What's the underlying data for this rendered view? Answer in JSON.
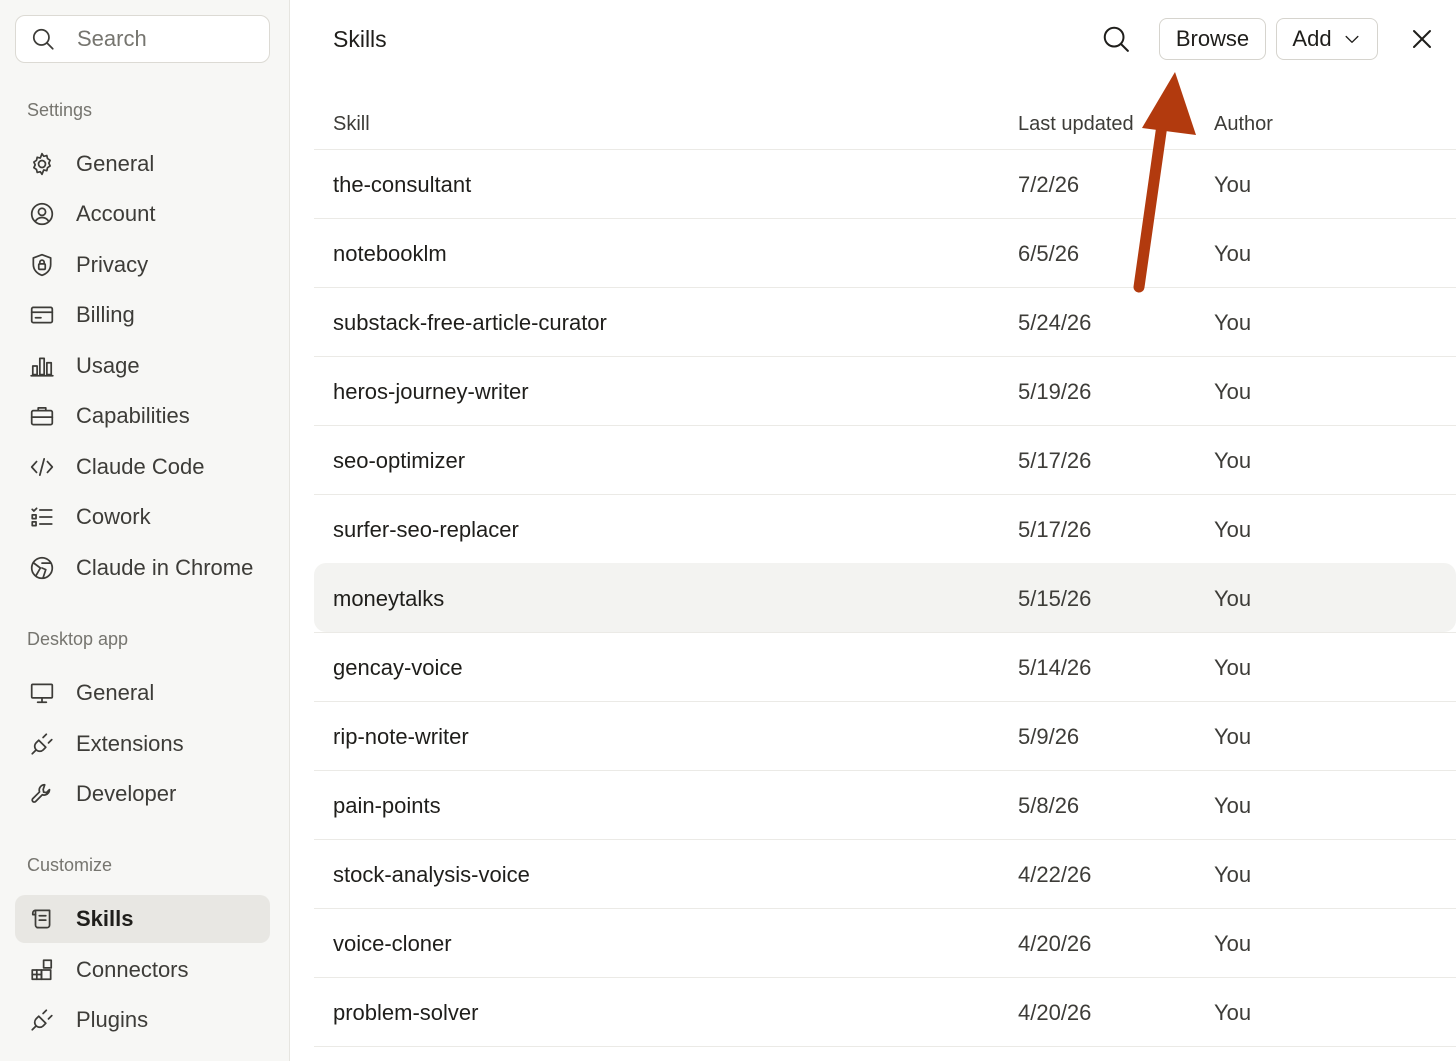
{
  "sidebar": {
    "search_placeholder": "Search",
    "sections": {
      "settings": "Settings",
      "desktop": "Desktop app",
      "customize": "Customize"
    },
    "settings_items": [
      {
        "label": "General",
        "icon": "gear-icon"
      },
      {
        "label": "Account",
        "icon": "user-circle-icon"
      },
      {
        "label": "Privacy",
        "icon": "shield-lock-icon"
      },
      {
        "label": "Billing",
        "icon": "credit-card-icon"
      },
      {
        "label": "Usage",
        "icon": "bar-chart-icon"
      },
      {
        "label": "Capabilities",
        "icon": "briefcase-icon"
      },
      {
        "label": "Claude Code",
        "icon": "code-icon"
      },
      {
        "label": "Cowork",
        "icon": "checklist-icon"
      },
      {
        "label": "Claude in Chrome",
        "icon": "globe-icon"
      }
    ],
    "desktop_items": [
      {
        "label": "General",
        "icon": "monitor-icon"
      },
      {
        "label": "Extensions",
        "icon": "plug-icon"
      },
      {
        "label": "Developer",
        "icon": "wrench-icon"
      }
    ],
    "customize_items": [
      {
        "label": "Skills",
        "icon": "scroll-icon",
        "active": true
      },
      {
        "label": "Connectors",
        "icon": "blocks-icon"
      },
      {
        "label": "Plugins",
        "icon": "plug-icon"
      }
    ]
  },
  "main": {
    "title": "Skills",
    "browse_label": "Browse",
    "add_label": "Add",
    "columns": {
      "skill": "Skill",
      "updated": "Last updated",
      "author": "Author"
    },
    "rows": [
      {
        "skill": "the-consultant",
        "updated": "7/2/26",
        "author": "You"
      },
      {
        "skill": "notebooklm",
        "updated": "6/5/26",
        "author": "You"
      },
      {
        "skill": "substack-free-article-curator",
        "updated": "5/24/26",
        "author": "You"
      },
      {
        "skill": "heros-journey-writer",
        "updated": "5/19/26",
        "author": "You"
      },
      {
        "skill": "seo-optimizer",
        "updated": "5/17/26",
        "author": "You"
      },
      {
        "skill": "surfer-seo-replacer",
        "updated": "5/17/26",
        "author": "You"
      },
      {
        "skill": "moneytalks",
        "updated": "5/15/26",
        "author": "You",
        "highlighted": true
      },
      {
        "skill": "gencay-voice",
        "updated": "5/14/26",
        "author": "You"
      },
      {
        "skill": "rip-note-writer",
        "updated": "5/9/26",
        "author": "You"
      },
      {
        "skill": "pain-points",
        "updated": "5/8/26",
        "author": "You"
      },
      {
        "skill": "stock-analysis-voice",
        "updated": "4/22/26",
        "author": "You"
      },
      {
        "skill": "voice-cloner",
        "updated": "4/20/26",
        "author": "You"
      },
      {
        "skill": "problem-solver",
        "updated": "4/20/26",
        "author": "You"
      }
    ]
  },
  "colors": {
    "sidebar_bg": "#f7f7f5",
    "active_bg": "#e8e7e3",
    "row_highlight": "#f3f3f1",
    "annotation_arrow": "#b23a0e"
  }
}
